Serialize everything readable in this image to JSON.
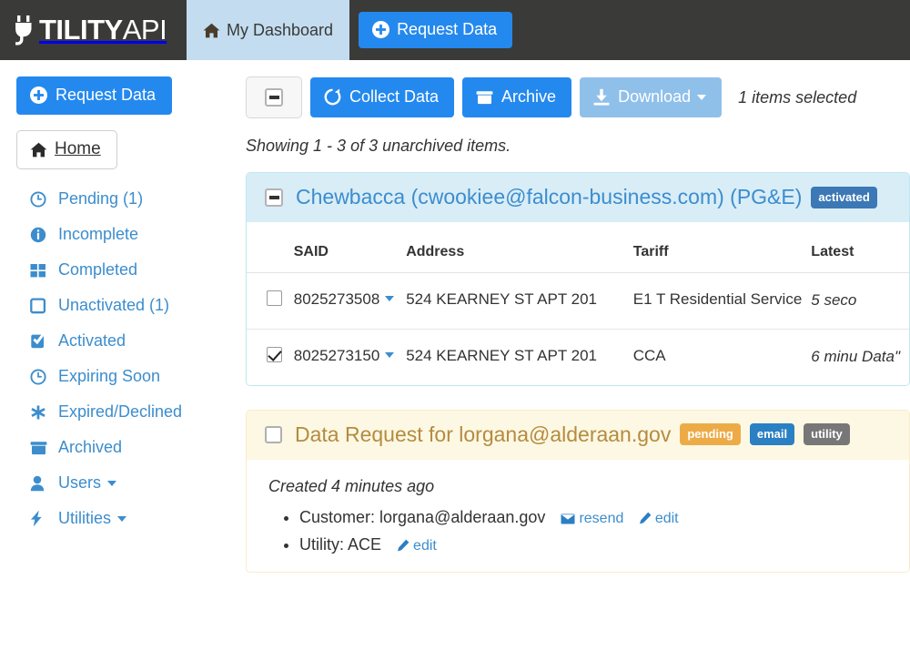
{
  "topnav": {
    "brand": {
      "plug": "plug-icon",
      "tility": "TILITY",
      "api": "API"
    },
    "tabs": [
      {
        "label": "My Dashboard",
        "icon": "home-icon",
        "active": true
      }
    ],
    "request_button": {
      "label": "Request Data",
      "icon": "plus-circle-icon"
    }
  },
  "sidebar": {
    "request_button": {
      "label": "Request Data",
      "icon": "plus-circle-icon"
    },
    "home": {
      "label": "Home",
      "icon": "home-icon"
    },
    "items": [
      {
        "label": "Pending (1)",
        "icon": "clock-icon"
      },
      {
        "label": "Incomplete",
        "icon": "info-circle-icon"
      },
      {
        "label": "Completed",
        "icon": "grid-icon"
      },
      {
        "label": "Unactivated (1)",
        "icon": "square-icon"
      },
      {
        "label": "Activated",
        "icon": "check-square-icon"
      },
      {
        "label": "Expiring Soon",
        "icon": "clock-icon"
      },
      {
        "label": "Expired/Declined",
        "icon": "asterisk-icon"
      },
      {
        "label": "Archived",
        "icon": "archive-icon"
      },
      {
        "label": "Users",
        "icon": "user-icon",
        "caret": true
      },
      {
        "label": "Utilities",
        "icon": "bolt-icon",
        "caret": true
      }
    ]
  },
  "toolbar": {
    "select_all": {
      "name": "select-all-checkbox",
      "state": "indeterminate"
    },
    "collect_label": "Collect Data",
    "collect_icon": "refresh-icon",
    "archive_label": "Archive",
    "archive_icon": "archive-icon",
    "download_label": "Download",
    "download_icon": "download-icon",
    "selection_status": "1 items selected"
  },
  "main": {
    "showing": "Showing 1 - 3 of 3 unarchived items."
  },
  "colors": {
    "brand_bar": "#3a3a38",
    "accent_blue": "#2489ee",
    "link_blue": "#3c8dcd",
    "tab_active": "#c3dcef",
    "info_bg": "#d9edf7",
    "info_border": "#bce8f1",
    "warning_bg": "#fcf8e3",
    "warning_border": "#faebcc",
    "warning_text": "#b58b40",
    "badge_primary": "#3b78b5",
    "badge_pending": "#edab48",
    "badge_email": "#2b7fc3",
    "badge_utility": "#777777",
    "download_muted": "#8fc0ea"
  },
  "cards": [
    {
      "type": "info",
      "checkbox_state": "indeterminate",
      "title": "Chewbacca (cwookiee@falcon-business.com) (PG&E)",
      "badges": [
        {
          "label": "activated",
          "style": "primary"
        }
      ],
      "table": {
        "columns": [
          "",
          "SAID",
          "Address",
          "Tariff",
          "Latest"
        ],
        "rows": [
          {
            "checked": false,
            "said": "8025273508",
            "address": "524 KEARNEY ST APT 201",
            "tariff": "E1 T Residential Service",
            "latest": "5 seco"
          },
          {
            "checked": true,
            "said": "8025273150",
            "address": "524 KEARNEY ST APT 201",
            "tariff": "CCA",
            "latest": "6 minu\nData\" "
          }
        ]
      }
    },
    {
      "type": "warning",
      "checkbox_state": "unchecked",
      "title": "Data Request for lorgana@alderaan.gov",
      "badges": [
        {
          "label": "pending",
          "style": "pending"
        },
        {
          "label": "email",
          "style": "email"
        },
        {
          "label": "utility",
          "style": "utility"
        }
      ],
      "created": "Created 4 minutes ago",
      "details": [
        {
          "text": "Customer: lorgana@alderaan.gov",
          "actions": [
            {
              "label": "resend",
              "icon": "envelope-icon"
            },
            {
              "label": "edit",
              "icon": "pencil-icon"
            }
          ]
        },
        {
          "text": "Utility: ACE",
          "actions": [
            {
              "label": "edit",
              "icon": "pencil-icon"
            }
          ]
        }
      ]
    }
  ]
}
